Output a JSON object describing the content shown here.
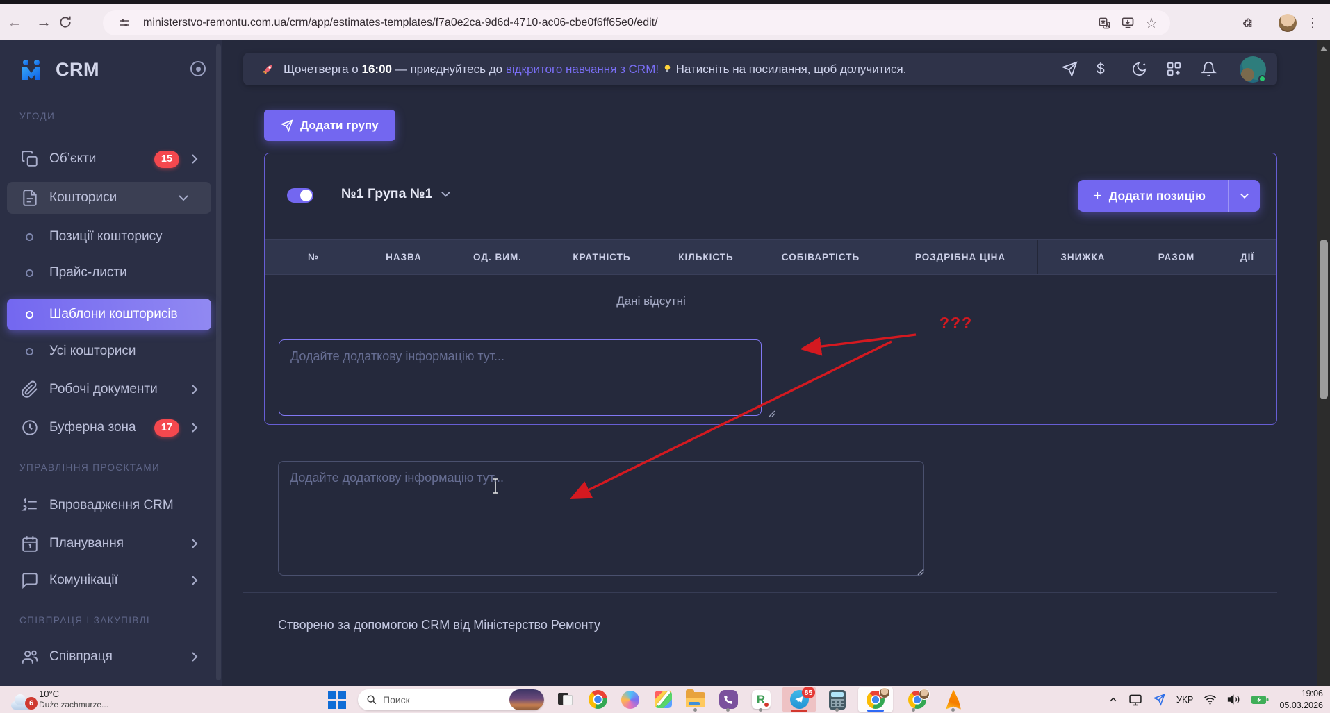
{
  "browser": {
    "url": "ministerstvo-remontu.com.ua/crm/app/estimates-templates/f7a0e2ca-9d6d-4710-ac06-cbe0f6ff65e0/edit/",
    "back_glyph": "←",
    "forward_glyph": "→",
    "star_glyph": "☆",
    "kebab_glyph": "⋮"
  },
  "sidebar": {
    "logo_text": "CRM",
    "sections": [
      "УГОДИ",
      "УПРАВЛІННЯ ПРОЄКТАМИ",
      "СПІВПРАЦЯ І ЗАКУПІВЛІ"
    ],
    "items": [
      {
        "label": "Об’єкти",
        "badge": "15"
      },
      {
        "label": "Кошториси"
      },
      {
        "label": "Позиції кошторису"
      },
      {
        "label": "Прайс-листи"
      },
      {
        "label": "Шаблони кошторисів"
      },
      {
        "label": "Усі кошториси"
      },
      {
        "label": "Робочі документи"
      },
      {
        "label": "Буферна зона",
        "badge": "17"
      },
      {
        "label": "Впровадження CRM"
      },
      {
        "label": "Планування"
      },
      {
        "label": "Комунікації"
      },
      {
        "label": "Співпраця"
      }
    ]
  },
  "banner": {
    "text_pre": "Щочетверга о",
    "time": "16:00",
    "text_mid": "— приєднуйтесь до",
    "link": "відкритого навчання з CRM!",
    "text_post": "Натисніть на посилання, щоб долучитися."
  },
  "toolbar": {
    "add_group_label": "Додати групу",
    "add_position_label": "Додати позицію",
    "plus_glyph": "+"
  },
  "group": {
    "title": "№1 Група №1"
  },
  "table": {
    "headers": [
      "№",
      "НАЗВА",
      "ОД. ВИМ.",
      "КРАТНІСТЬ",
      "КІЛЬКІСТЬ",
      "СОБІВАРТІСТЬ",
      "РОЗДРІБНА ЦІНА",
      "ЗНИЖКА",
      "РАЗОМ",
      "ДІЇ"
    ],
    "empty_text": "Дані відсутні"
  },
  "notes": {
    "placeholder": "Додайте додаткову інформацію тут..."
  },
  "footer": {
    "text": "Створено за допомогою CRM від Міністерство Ремонту"
  },
  "annotation": {
    "question": "???",
    "color": "#d41920"
  },
  "icons_misc": {
    "dollar": "$"
  },
  "colors": {
    "accent": "#7367f0",
    "danger": "#ff4c51",
    "link": "#7a6ff6"
  },
  "taskbar": {
    "weather_temp": "10°C",
    "weather_desc": "Duże zachmurze...",
    "weather_badge": "6",
    "search_placeholder": "Поиск",
    "telegram_badge": "85",
    "language": "УКР",
    "time": "19:06",
    "date": "05.03.2026"
  }
}
